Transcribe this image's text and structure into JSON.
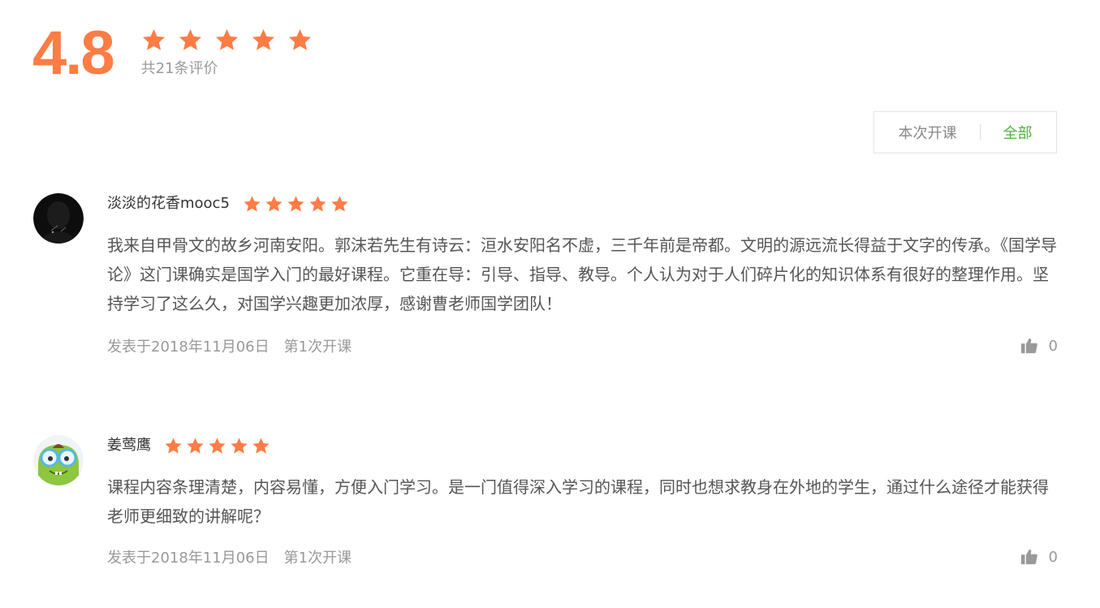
{
  "summary": {
    "score": "4.8",
    "rating": 5,
    "count_label": "共21条评价"
  },
  "filter": {
    "current_label": "本次开课",
    "all_label": "全部",
    "selected": "all"
  },
  "colors": {
    "accent_orange": "#ff7c45",
    "active_green": "#4bb43a",
    "muted_gray": "#999999"
  },
  "reviews": [
    {
      "username": "淡淡的花香mooc5",
      "avatar_icon": "dark-silhouette-avatar",
      "rating": 5,
      "text": "我来自甲骨文的故乡河南安阳。郭沫若先生有诗云：洹水安阳名不虚，三千年前是帝都。文明的源远流长得益于文字的传承。《国学导论》这门课确实是国学入门的最好课程。它重在导：引导、指导、教导。个人认为对于人们碎片化的知识体系有很好的整理作用。坚持学习了这么久，对国学兴趣更加浓厚，感谢曹老师国学团队！",
      "date": "发表于2018年11月06日",
      "term": "第1次开课",
      "likes": "0"
    },
    {
      "username": "姜莺鹰",
      "avatar_icon": "green-monster-avatar",
      "rating": 5,
      "text": "课程内容条理清楚，内容易懂，方便入门学习。是一门值得深入学习的课程，同时也想求教身在外地的学生，通过什么途径才能获得老师更细致的讲解呢？",
      "date": "发表于2018年11月06日",
      "term": "第1次开课",
      "likes": "0"
    }
  ],
  "icons": {
    "star": "star-icon",
    "like": "thumbs-up-icon"
  }
}
